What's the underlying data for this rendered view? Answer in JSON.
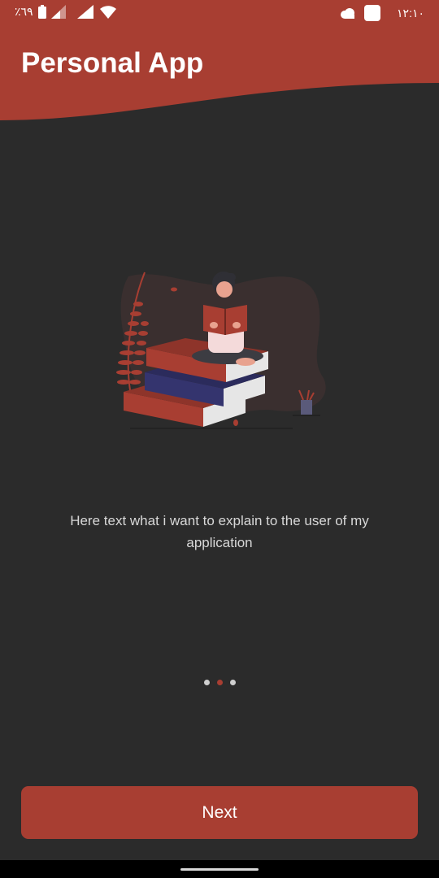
{
  "status_bar": {
    "battery_percent": "٪٦٩",
    "time": "١٢:١٠",
    "icons": [
      "battery-icon",
      "signal-icon",
      "signal-icon",
      "wifi-icon",
      "cloud-icon",
      "notification-icon"
    ]
  },
  "header": {
    "title": "Personal App"
  },
  "illustration": {
    "icon": "woman-reading-on-books-illustration"
  },
  "onboarding": {
    "description": "Here text what i want to explain to the user of my application",
    "page_indicator": {
      "count": 3,
      "active_index": 1
    }
  },
  "actions": {
    "next_label": "Next"
  },
  "colors": {
    "accent": "#a83e32",
    "background": "#2b2b2b",
    "text": "#d8d8d8"
  }
}
